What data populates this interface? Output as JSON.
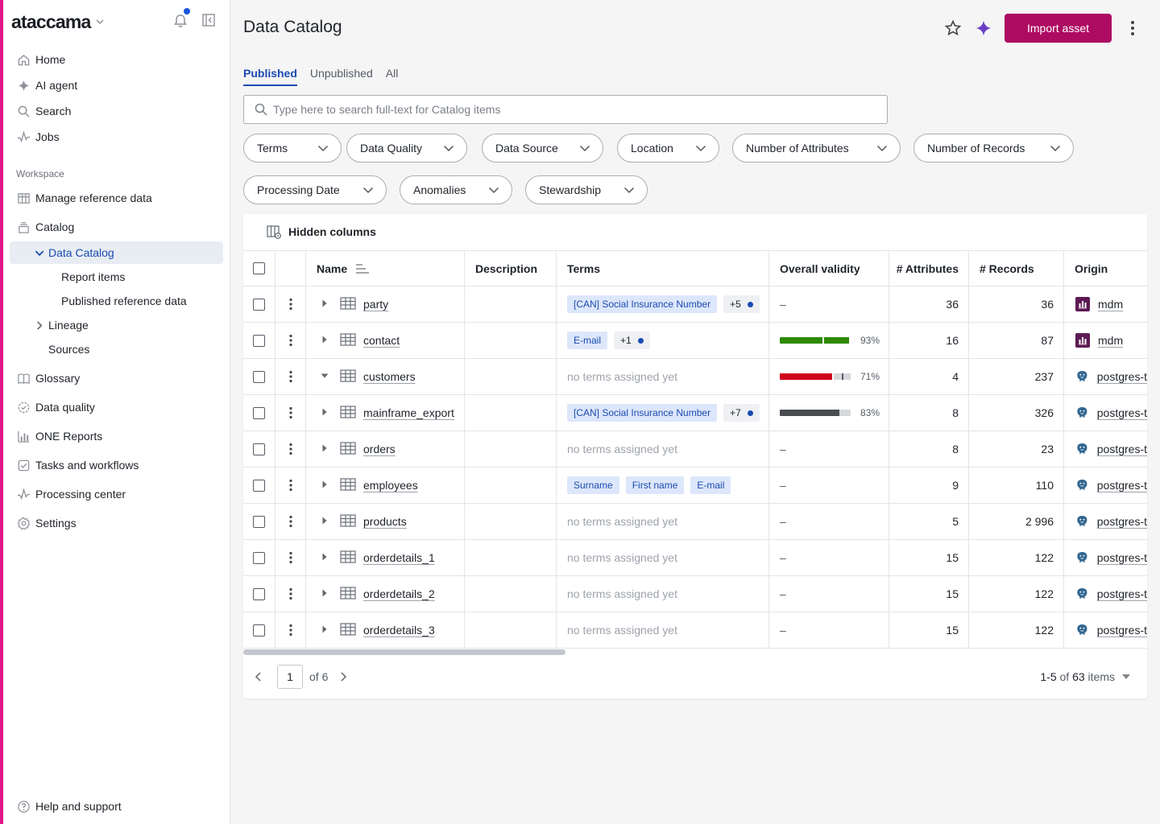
{
  "app": {
    "brand": "ataccama"
  },
  "sidebar": {
    "top_items": [
      {
        "label": "Home",
        "icon": "home-icon"
      },
      {
        "label": "AI agent",
        "icon": "sparkle-icon"
      },
      {
        "label": "Search",
        "icon": "search-icon"
      },
      {
        "label": "Jobs",
        "icon": "pulse-icon"
      }
    ],
    "section_workspace": "Workspace",
    "workspace_items": [
      {
        "label": "Manage reference data",
        "icon": "table-icon"
      },
      {
        "label": "Catalog",
        "icon": "catalog-icon"
      },
      {
        "label": "Data Catalog",
        "icon": "chevron-down-icon",
        "active": true
      },
      {
        "label": "Report items"
      },
      {
        "label": "Published reference data"
      },
      {
        "label": "Lineage",
        "icon": "chevron-right-icon"
      },
      {
        "label": "Sources"
      },
      {
        "label": "Glossary",
        "icon": "book-icon"
      },
      {
        "label": "Data quality",
        "icon": "quality-icon"
      },
      {
        "label": "ONE Reports",
        "icon": "bar-chart-icon"
      },
      {
        "label": "Tasks and workflows",
        "icon": "checkbox-icon"
      },
      {
        "label": "Processing center",
        "icon": "pulse-icon"
      },
      {
        "label": "Settings",
        "icon": "gear-icon"
      }
    ],
    "help": "Help and support"
  },
  "header": {
    "title": "Data Catalog",
    "import_label": "Import asset"
  },
  "tabs": [
    {
      "label": "Published",
      "active": true
    },
    {
      "label": "Unpublished"
    },
    {
      "label": "All"
    }
  ],
  "search": {
    "placeholder": "Type here to search full-text for Catalog items"
  },
  "filters": [
    "Terms",
    "Data Quality",
    "Data Source",
    "Location",
    "Number of Attributes",
    "Number of Records",
    "Processing Date",
    "Anomalies",
    "Stewardship"
  ],
  "table": {
    "hidden_columns_label": "Hidden columns",
    "columns": [
      "Name",
      "Description",
      "Terms",
      "Overall validity",
      "# Attributes",
      "# Records",
      "Origin"
    ],
    "no_terms_text": "no terms assigned yet",
    "dash": "–",
    "rows": [
      {
        "name": "party",
        "terms": [
          "[CAN] Social Insurance Number"
        ],
        "more": "+5",
        "validity": null,
        "attributes": "36",
        "records": "36",
        "origin": "mdm",
        "origin_type": "mdm",
        "expanded": false
      },
      {
        "name": "contact",
        "terms": [
          "E-mail"
        ],
        "more": "+1",
        "validity": {
          "pct": "93%",
          "segments": [
            {
              "w": 0.6,
              "c": "#2e8a00"
            },
            {
              "w": 0.02,
              "c": "#ffffff"
            },
            {
              "w": 0.36,
              "c": "#2e8a00"
            }
          ]
        },
        "attributes": "16",
        "records": "87",
        "origin": "mdm",
        "origin_type": "mdm",
        "expanded": false
      },
      {
        "name": "customers",
        "terms": [],
        "more": "",
        "validity": {
          "pct": "71%",
          "segments": [
            {
              "w": 0.74,
              "c": "#d0021b"
            },
            {
              "w": 0.02,
              "c": "#ffffff"
            },
            {
              "w": 0.12,
              "c": "#d6d8dc"
            },
            {
              "w": 0.02,
              "c": "#555b65"
            },
            {
              "w": 0.1,
              "c": "#d6d8dc"
            }
          ]
        },
        "attributes": "4",
        "records": "237",
        "origin": "postgres-t",
        "origin_type": "pg",
        "expanded": true
      },
      {
        "name": "mainframe_export",
        "terms": [
          "[CAN] Social Insurance Number"
        ],
        "more": "+7",
        "validity": {
          "pct": "83%",
          "segments": [
            {
              "w": 0.84,
              "c": "#4a4d52"
            },
            {
              "w": 0.16,
              "c": "#d6d8dc"
            }
          ]
        },
        "attributes": "8",
        "records": "326",
        "origin": "postgres-t",
        "origin_type": "pg",
        "expanded": false
      },
      {
        "name": "orders",
        "terms": [],
        "more": "",
        "validity": null,
        "attributes": "8",
        "records": "23",
        "origin": "postgres-t",
        "origin_type": "pg",
        "expanded": false
      },
      {
        "name": "employees",
        "terms": [
          "Surname",
          "First name",
          "E-mail"
        ],
        "more": "",
        "validity": null,
        "attributes": "9",
        "records": "110",
        "origin": "postgres-t",
        "origin_type": "pg",
        "expanded": false
      },
      {
        "name": "products",
        "terms": [],
        "more": "",
        "validity": null,
        "attributes": "5",
        "records": "2 996",
        "origin": "postgres-t",
        "origin_type": "pg",
        "expanded": false
      },
      {
        "name": "orderdetails_1",
        "terms": [],
        "more": "",
        "validity": null,
        "attributes": "15",
        "records": "122",
        "origin": "postgres-t",
        "origin_type": "pg",
        "expanded": false
      },
      {
        "name": "orderdetails_2",
        "terms": [],
        "more": "",
        "validity": null,
        "attributes": "15",
        "records": "122",
        "origin": "postgres-t",
        "origin_type": "pg",
        "expanded": false
      },
      {
        "name": "orderdetails_3",
        "terms": [],
        "more": "",
        "validity": null,
        "attributes": "15",
        "records": "122",
        "origin": "postgres-t",
        "origin_type": "pg",
        "expanded": false
      }
    ]
  },
  "pagination": {
    "page": "1",
    "of_label": "of 6",
    "range": "1-5",
    "of_word": "of",
    "total": "63",
    "items_word": "items"
  }
}
